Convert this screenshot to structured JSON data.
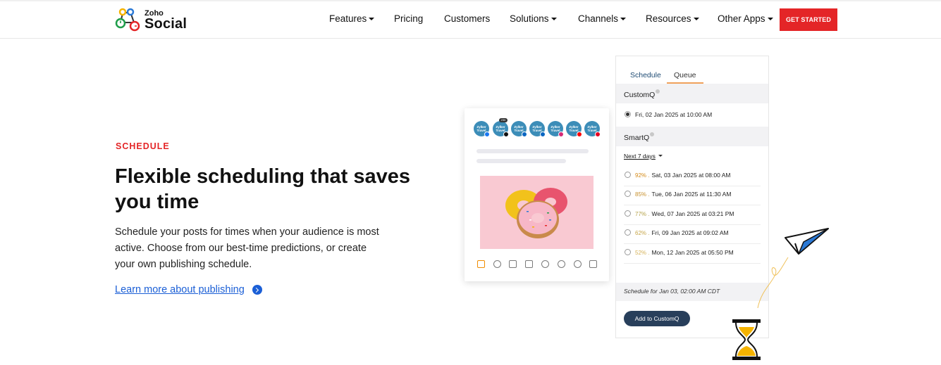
{
  "nav": {
    "logo_small": "Zoho",
    "logo_big": "Social",
    "items": [
      {
        "label": "Features",
        "dropdown": true
      },
      {
        "label": "Pricing",
        "dropdown": false
      },
      {
        "label": "Customers",
        "dropdown": false
      },
      {
        "label": "Solutions",
        "dropdown": true
      },
      {
        "label": "Channels",
        "dropdown": true
      },
      {
        "label": "Resources",
        "dropdown": true
      },
      {
        "label": "Other Apps",
        "dropdown": true
      }
    ],
    "cta": "GET STARTED"
  },
  "hero": {
    "eyebrow": "SCHEDULE",
    "headline": "Flexible scheduling that saves you time",
    "description": "Schedule your posts for times when your audience is most active. Choose from our best-time predictions, or create your own publishing schedule.",
    "link": "Learn more about publishing"
  },
  "composer": {
    "avatar_text": "Zylker Travel",
    "badge": "230",
    "networks": [
      "facebook",
      "x",
      "linkedin",
      "linkedin-page",
      "instagram",
      "youtube",
      "pinterest"
    ],
    "tools": [
      "image-icon",
      "location-icon",
      "mail-icon",
      "media-icon",
      "refresh-icon",
      "pinterest-icon",
      "emoji-icon",
      "chart-icon"
    ]
  },
  "schedule_panel": {
    "tabs": [
      "Schedule",
      "Queue"
    ],
    "active_tab": "Queue",
    "customq": {
      "title": "CustomQ",
      "slot": "Fri, 02 Jan 2025 at 10:00 AM"
    },
    "smartq": {
      "title": "SmartQ",
      "filter": "Next 7 days",
      "slots": [
        {
          "pct": "92% .",
          "time": "Sat, 03 Jan 2025 at 08:00 AM",
          "color": "#d48a17"
        },
        {
          "pct": "85% .",
          "time": "Tue, 06 Jan 2025 at 11:30 AM",
          "color": "#c7902c"
        },
        {
          "pct": "77% .",
          "time": "Wed, 07 Jan 2025 at 03:21 PM",
          "color": "#b5a24a"
        },
        {
          "pct": "62% .",
          "time": "Fri, 09 Jan 2025 at 09:02 AM",
          "color": "#c7a64a"
        },
        {
          "pct": "52% .",
          "time": "Mon, 12 Jan 2025 at 05:50 PM",
          "color": "#d6b35a"
        }
      ]
    },
    "footer_note": "Schedule for Jan 03, 02:00 AM CDT",
    "add_button": "Add to CustomQ"
  },
  "colors": {
    "brand_red": "#e42527",
    "link_blue": "#1b5fd6",
    "button_navy": "#283f5b",
    "tab_underline": "#f0a15a"
  }
}
